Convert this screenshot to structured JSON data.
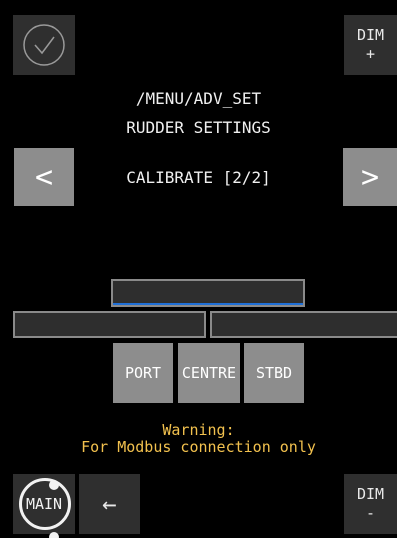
{
  "header": {
    "path": "/MENU/ADV_SET",
    "title": "RUDDER SETTINGS",
    "step": "CALIBRATE [2/2]"
  },
  "nav": {
    "prev_label": "<",
    "next_label": ">"
  },
  "dim": {
    "plus_top": "DIM",
    "plus_bottom": "+",
    "minus_top": "DIM",
    "minus_bottom": "-"
  },
  "actions": {
    "port": "PORT",
    "centre": "CENTRE",
    "stbd": "STBD"
  },
  "warning": {
    "line1": "Warning:",
    "line2": "For Modbus connection only"
  },
  "bottom": {
    "main_label": "MAIN",
    "back_label": "←"
  },
  "colors": {
    "accent": "#1f6fd6",
    "warning": "#f2c14e",
    "button_dark": "#2f2f2f",
    "button_light": "#8d8d8d"
  },
  "icons": {
    "confirm": "check-circle-icon",
    "back": "arrow-left-icon",
    "main": "main-ring-icon"
  }
}
